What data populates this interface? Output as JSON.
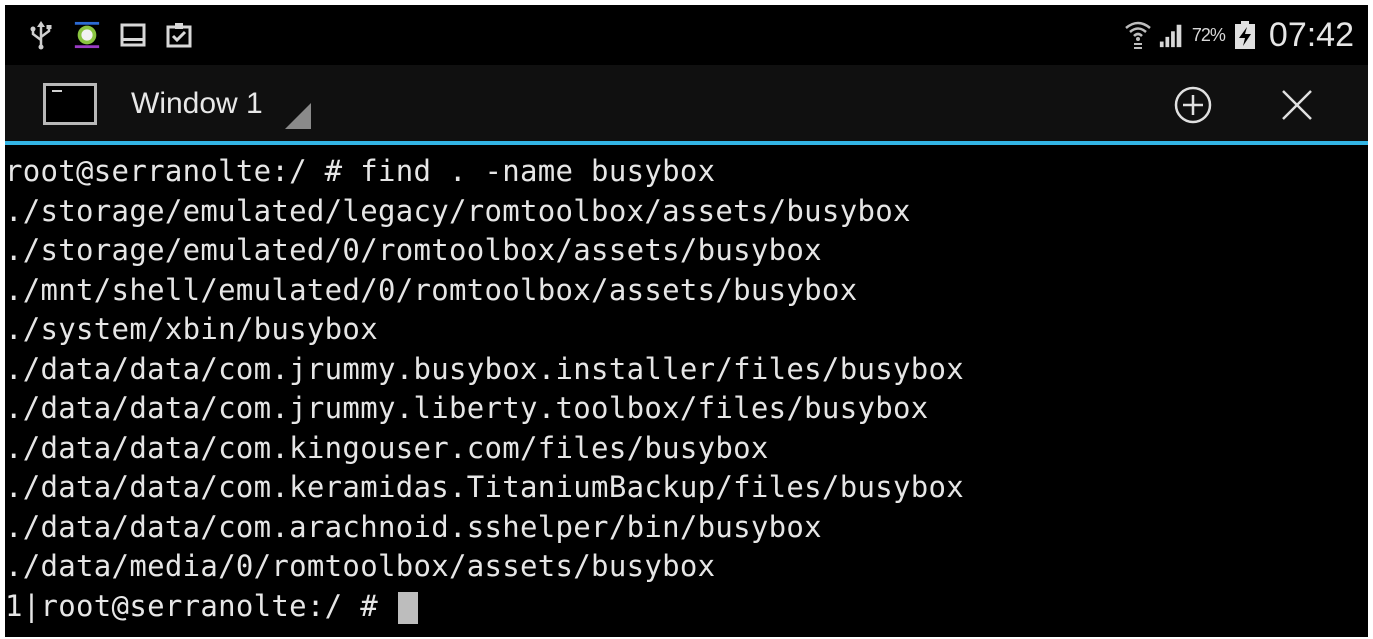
{
  "status_bar": {
    "left_icons": [
      "usb-icon",
      "app-notification-icon",
      "screen-icon",
      "clipboard-icon"
    ],
    "right_icons": [
      "wifi-icon",
      "signal-icon",
      "battery-charging-icon"
    ],
    "battery_percent": "72%",
    "time": "07:42"
  },
  "tab_bar": {
    "window_label": "Window 1",
    "new_window_icon": "plus-circle-icon",
    "close_icon": "close-icon",
    "accent_color": "#33b5e5"
  },
  "terminal": {
    "lines": [
      "root@serranolte:/ # find . -name busybox",
      "./storage/emulated/legacy/romtoolbox/assets/busybox",
      "./storage/emulated/0/romtoolbox/assets/busybox",
      "./mnt/shell/emulated/0/romtoolbox/assets/busybox",
      "./system/xbin/busybox",
      "./data/data/com.jrummy.busybox.installer/files/busybox",
      "./data/data/com.jrummy.liberty.toolbox/files/busybox",
      "./data/data/com.kingouser.com/files/busybox",
      "./data/data/com.keramidas.TitaniumBackup/files/busybox",
      "./data/data/com.arachnoid.sshelper/bin/busybox",
      "./data/media/0/romtoolbox/assets/busybox"
    ],
    "prompt": "1|root@serranolte:/ # "
  }
}
